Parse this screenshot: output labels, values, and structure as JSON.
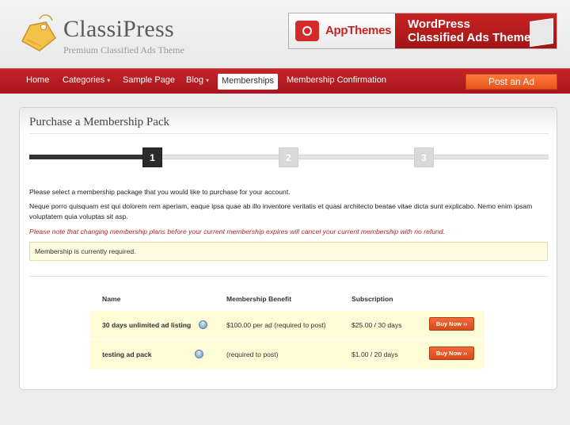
{
  "header": {
    "logo_title": "ClassiPress",
    "logo_subtitle": "Premium Classified Ads Theme",
    "banner": {
      "brand": "AppThemes",
      "line1": "WordPress",
      "line2": "Classified Ads Theme"
    }
  },
  "nav": {
    "items": [
      {
        "label": "Home"
      },
      {
        "label": "Categories"
      },
      {
        "label": "Sample Page"
      },
      {
        "label": "Blog"
      },
      {
        "label": "Memberships"
      },
      {
        "label": "Membership Confirmation"
      }
    ],
    "active": "Memberships",
    "post_ad_label": "Post an Ad",
    "accent_color": "#b91c22"
  },
  "main": {
    "title": "Purchase a Membership Pack",
    "steps": [
      "1",
      "2",
      "3"
    ],
    "current_step": 1,
    "intro": "Please select a membership package that you would like to purchase for your account.",
    "lorem": "Neque porro quisquam est qui dolorem rem aperiam, eaque ipsa quae ab illo inventore veritatis et quasi architecto beatae vitae dicta sunt explicabo. Nemo enim ipsam voluptatem quia voluptas sit asp.",
    "warning": "Please note that changing membership plans before your current membership expires will cancel your current membership with no refund.",
    "notice": "Membership is currently required."
  },
  "table": {
    "headers": [
      "Name",
      "Membership Benefit",
      "Subscription"
    ],
    "rows": [
      {
        "name": "30 days unlimited ad listing",
        "benefit": "$100.00 per ad (required to post)",
        "subscription": "$25.00 / 30 days",
        "button": "Buy Now ››"
      },
      {
        "name": "testing ad pack",
        "benefit": "(required to post)",
        "subscription": "$1.00 / 20 days",
        "button": "Buy Now ››"
      }
    ]
  }
}
